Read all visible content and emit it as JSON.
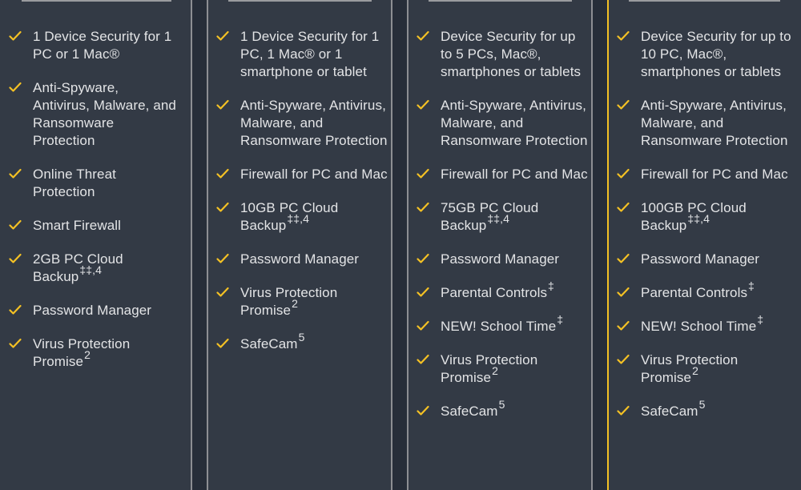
{
  "colors": {
    "background": "#272e39",
    "card": "#333a45",
    "card_border": "#8d8f93",
    "highlight_border": "#f4c124",
    "check": "#f4c124",
    "text": "#e3e4e6"
  },
  "plans": [
    {
      "highlighted": false,
      "features": [
        {
          "text": "1 Device Security for 1 PC or 1 Mac®",
          "sup": ""
        },
        {
          "text": "Anti-Spyware, Antivirus, Malware, and Ransomware Protection",
          "sup": ""
        },
        {
          "text": "Online Threat Protection",
          "sup": ""
        },
        {
          "text": "Smart Firewall",
          "sup": ""
        },
        {
          "text": "2GB PC Cloud Backup",
          "sup": "‡‡,4"
        },
        {
          "text": "Password Manager",
          "sup": ""
        },
        {
          "text": "Virus Protection Promise",
          "sup": "2"
        }
      ]
    },
    {
      "highlighted": false,
      "features": [
        {
          "text": "1 Device Security for 1 PC, 1 Mac® or 1 smartphone or tablet",
          "sup": ""
        },
        {
          "text": "Anti-Spyware, Antivirus, Malware, and Ransomware Protection",
          "sup": ""
        },
        {
          "text": "Firewall for PC and Mac",
          "sup": ""
        },
        {
          "text": "10GB PC Cloud Backup",
          "sup": "‡‡,4"
        },
        {
          "text": "Password Manager",
          "sup": ""
        },
        {
          "text": "Virus Protection Promise",
          "sup": "2"
        },
        {
          "text": "SafeCam",
          "sup": "5"
        }
      ]
    },
    {
      "highlighted": false,
      "features": [
        {
          "text": "Device Security for up to 5 PCs, Mac®, smartphones or tablets",
          "sup": ""
        },
        {
          "text": "Anti-Spyware, Antivirus, Malware, and Ransomware Protection",
          "sup": ""
        },
        {
          "text": "Firewall for PC and Mac",
          "sup": ""
        },
        {
          "text": "75GB PC Cloud Backup",
          "sup": "‡‡,4"
        },
        {
          "text": "Password Manager",
          "sup": ""
        },
        {
          "text": "Parental Controls",
          "sup": "‡"
        },
        {
          "text": "NEW! School Time",
          "sup": "‡"
        },
        {
          "text": "Virus Protection Promise",
          "sup": "2"
        },
        {
          "text": "SafeCam",
          "sup": "5"
        }
      ]
    },
    {
      "highlighted": true,
      "features": [
        {
          "text": "Device Security for up to 10 PC, Mac®, smartphones or tablets",
          "sup": ""
        },
        {
          "text": "Anti-Spyware, Antivirus, Malware, and Ransomware Protection",
          "sup": ""
        },
        {
          "text": "Firewall for PC and Mac",
          "sup": ""
        },
        {
          "text": "100GB PC Cloud Backup",
          "sup": "‡‡,4"
        },
        {
          "text": "Password Manager",
          "sup": ""
        },
        {
          "text": "Parental Controls",
          "sup": "‡"
        },
        {
          "text": "NEW! School Time",
          "sup": "‡"
        },
        {
          "text": "Virus Protection Promise",
          "sup": "2"
        },
        {
          "text": "SafeCam",
          "sup": "5"
        }
      ]
    }
  ]
}
